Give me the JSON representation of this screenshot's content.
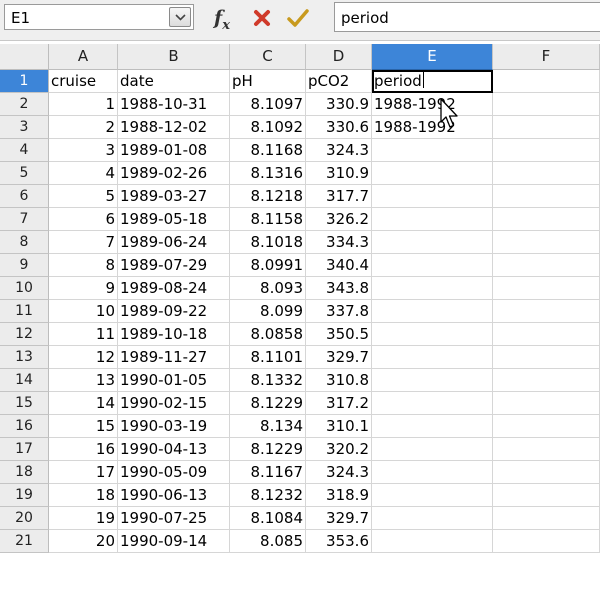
{
  "formula_bar": {
    "name_box": "E1",
    "name_box_dropdown_icon": "chevron-down-icon",
    "function_wizard_icon": "fx-icon",
    "cancel_icon": "cross-icon",
    "accept_icon": "checkmark-icon",
    "input_value": "period"
  },
  "columns": [
    "A",
    "B",
    "C",
    "D",
    "E",
    "F"
  ],
  "selected_column": "E",
  "active_cell": "E1",
  "rows": [
    {
      "n": "1",
      "A": "cruise",
      "B": "date",
      "C": "pH",
      "D": "pCO2",
      "E": "period",
      "F": ""
    },
    {
      "n": "2",
      "A": "1",
      "B": "1988-10-31",
      "C": "8.1097",
      "D": "330.9",
      "E": "1988-1992",
      "F": ""
    },
    {
      "n": "3",
      "A": "2",
      "B": "1988-12-02",
      "C": "8.1092",
      "D": "330.6",
      "E": "1988-1992",
      "F": ""
    },
    {
      "n": "4",
      "A": "3",
      "B": "1989-01-08",
      "C": "8.1168",
      "D": "324.3",
      "E": "",
      "F": ""
    },
    {
      "n": "5",
      "A": "4",
      "B": "1989-02-26",
      "C": "8.1316",
      "D": "310.9",
      "E": "",
      "F": ""
    },
    {
      "n": "6",
      "A": "5",
      "B": "1989-03-27",
      "C": "8.1218",
      "D": "317.7",
      "E": "",
      "F": ""
    },
    {
      "n": "7",
      "A": "6",
      "B": "1989-05-18",
      "C": "8.1158",
      "D": "326.2",
      "E": "",
      "F": ""
    },
    {
      "n": "8",
      "A": "7",
      "B": "1989-06-24",
      "C": "8.1018",
      "D": "334.3",
      "E": "",
      "F": ""
    },
    {
      "n": "9",
      "A": "8",
      "B": "1989-07-29",
      "C": "8.0991",
      "D": "340.4",
      "E": "",
      "F": ""
    },
    {
      "n": "10",
      "A": "9",
      "B": "1989-08-24",
      "C": "8.093",
      "D": "343.8",
      "E": "",
      "F": ""
    },
    {
      "n": "11",
      "A": "10",
      "B": "1989-09-22",
      "C": "8.099",
      "D": "337.8",
      "E": "",
      "F": ""
    },
    {
      "n": "12",
      "A": "11",
      "B": "1989-10-18",
      "C": "8.0858",
      "D": "350.5",
      "E": "",
      "F": ""
    },
    {
      "n": "13",
      "A": "12",
      "B": "1989-11-27",
      "C": "8.1101",
      "D": "329.7",
      "E": "",
      "F": ""
    },
    {
      "n": "14",
      "A": "13",
      "B": "1990-01-05",
      "C": "8.1332",
      "D": "310.8",
      "E": "",
      "F": ""
    },
    {
      "n": "15",
      "A": "14",
      "B": "1990-02-15",
      "C": "8.1229",
      "D": "317.2",
      "E": "",
      "F": ""
    },
    {
      "n": "16",
      "A": "15",
      "B": "1990-03-19",
      "C": "8.134",
      "D": "310.1",
      "E": "",
      "F": ""
    },
    {
      "n": "17",
      "A": "16",
      "B": "1990-04-13",
      "C": "8.1229",
      "D": "320.2",
      "E": "",
      "F": ""
    },
    {
      "n": "18",
      "A": "17",
      "B": "1990-05-09",
      "C": "8.1167",
      "D": "324.3",
      "E": "",
      "F": ""
    },
    {
      "n": "19",
      "A": "18",
      "B": "1990-06-13",
      "C": "8.1232",
      "D": "318.9",
      "E": "",
      "F": ""
    },
    {
      "n": "20",
      "A": "19",
      "B": "1990-07-25",
      "C": "8.1084",
      "D": "329.7",
      "E": "",
      "F": ""
    },
    {
      "n": "21",
      "A": "20",
      "B": "1990-09-14",
      "C": "8.085",
      "D": "353.6",
      "E": "",
      "F": ""
    }
  ],
  "colors": {
    "selection_header": "#3d85d8",
    "cancel_icon": "#d03a2a",
    "accept_icon": "#c89a1e"
  },
  "mouse_cursor_icon": "arrow-cursor-icon"
}
